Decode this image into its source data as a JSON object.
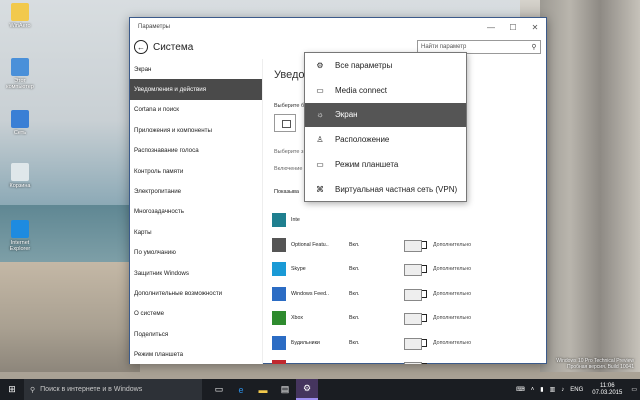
{
  "desktop": {
    "icons": [
      {
        "label": "WinAero",
        "icon": "folder-icon",
        "color": "#f2c94c"
      },
      {
        "label": "Этот компьютер",
        "icon": "computer-icon",
        "color": "#4a90d9"
      },
      {
        "label": "Сеть",
        "icon": "network-icon",
        "color": "#3a7fd5"
      },
      {
        "label": "Корзина",
        "icon": "recycle-bin-icon",
        "color": "#dfe7ea"
      },
      {
        "label": "Internet Explorer",
        "icon": "ie-icon",
        "color": "#1e8be0"
      }
    ],
    "watermark": [
      "Windows 10 Pro Technical Preview",
      "Пробная версия. Build 10041"
    ]
  },
  "window": {
    "title": "Параметры",
    "header_title": "Система",
    "search_placeholder": "Найти параметр",
    "sidebar": [
      {
        "label": "Экран"
      },
      {
        "label": "Уведомления и действия",
        "active": true
      },
      {
        "label": "Cortana и поиск"
      },
      {
        "label": "Приложения и компоненты"
      },
      {
        "label": "Распознавание голоса"
      },
      {
        "label": "Контроль памяти"
      },
      {
        "label": "Электропитание"
      },
      {
        "label": "Многозадачность"
      },
      {
        "label": "Карты"
      },
      {
        "label": "По умолчанию"
      },
      {
        "label": "Защитник Windows"
      },
      {
        "label": "Дополнительные возможности"
      },
      {
        "label": "О системе"
      },
      {
        "label": "Поделиться"
      },
      {
        "label": "Режим планшета"
      }
    ],
    "main": {
      "title": "Уведо",
      "sub1": "Выберите б",
      "sub2": "Выберите з",
      "sub3": "Включение",
      "show": "Показыва",
      "apps": [
        {
          "name": "Inte",
          "state": "",
          "more": "",
          "color": "#1f7f8f",
          "icon": "app-icon"
        },
        {
          "name": "Optional Featu...",
          "state": "Вкл.",
          "more": "Дополнительно",
          "color": "#555555",
          "icon": "optional-features-icon"
        },
        {
          "name": "Skype",
          "state": "Вкл.",
          "more": "Дополнительно",
          "color": "#1a9ad6",
          "icon": "skype-icon"
        },
        {
          "name": "Windows Feed...",
          "state": "Вкл.",
          "more": "Дополнительно",
          "color": "#2b6cc4",
          "icon": "feedback-icon"
        },
        {
          "name": "Xbox",
          "state": "Вкл.",
          "more": "Дополнительно",
          "color": "#2e8b2e",
          "icon": "xbox-icon"
        },
        {
          "name": "Будильники",
          "state": "Вкл.",
          "more": "Дополнительно",
          "color": "#2b6cc4",
          "icon": "alarm-icon"
        },
        {
          "name": "Видео",
          "state": "Вкл.",
          "more": "Дополнительно",
          "color": "#c0282e",
          "icon": "video-icon"
        }
      ]
    }
  },
  "dropdown": {
    "items": [
      {
        "label": "Все параметры",
        "icon": "⚙",
        "icon_name": "gear-icon"
      },
      {
        "label": "Media connect",
        "icon": "▭",
        "icon_name": "media-connect-icon"
      },
      {
        "label": "Экран",
        "icon": "☼",
        "icon_name": "display-icon",
        "active": true
      },
      {
        "label": "Расположение",
        "icon": "♙",
        "icon_name": "location-icon"
      },
      {
        "label": "Режим планшета",
        "icon": "▭",
        "icon_name": "tablet-mode-icon"
      },
      {
        "label": "Виртуальная частная сеть (VPN)",
        "icon": "⌘",
        "icon_name": "vpn-icon"
      }
    ]
  },
  "taskbar": {
    "search_placeholder": "Поиск в интернете и в Windows",
    "language": "ENG",
    "time": "11:06",
    "date": "07.03.2015"
  }
}
